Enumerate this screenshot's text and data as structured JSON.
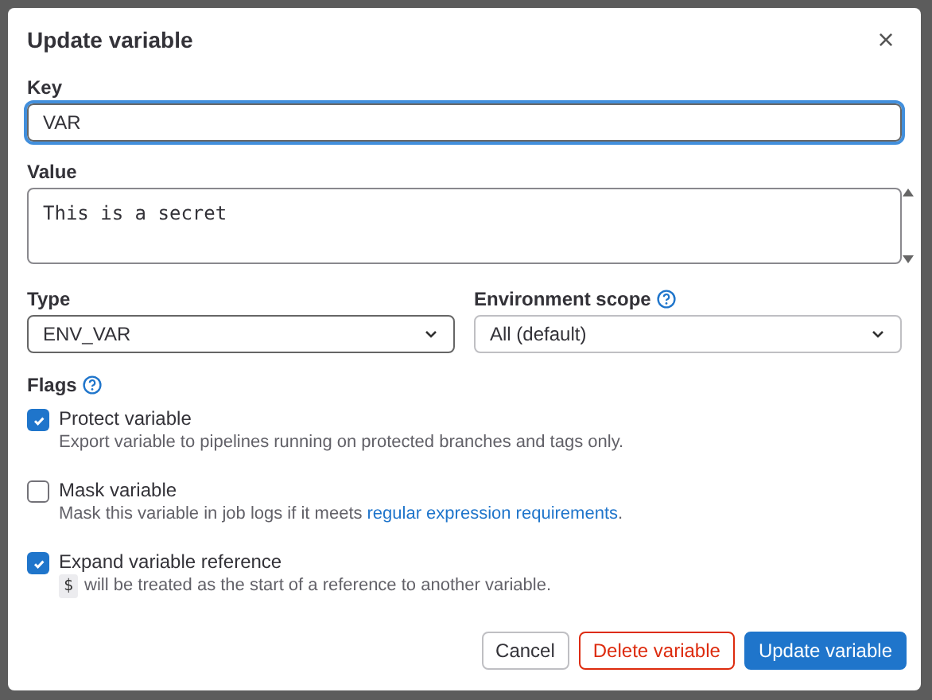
{
  "dialog": {
    "title": "Update variable",
    "close": "×"
  },
  "key": {
    "label": "Key",
    "value": "VAR"
  },
  "value": {
    "label": "Value",
    "value": "This is a secret"
  },
  "type": {
    "label": "Type",
    "value": "ENV_VAR"
  },
  "environment_scope": {
    "label": "Environment scope",
    "value": "All (default)"
  },
  "flags": {
    "label": "Flags",
    "items": [
      {
        "label": "Protect variable",
        "checked": true,
        "description": "Export variable to pipelines running on protected branches and tags only."
      },
      {
        "label": "Mask variable",
        "checked": false,
        "description": "Mask this variable in job logs if it meets",
        "link": "regular expression requirements",
        "description_after": "."
      },
      {
        "label": "Expand variable reference",
        "checked": true,
        "code": "$",
        "description": "will be treated as the start of a reference to another variable."
      }
    ]
  },
  "buttons": [
    {
      "label": "Cancel",
      "kind": "default"
    },
    {
      "label": "Delete variable",
      "kind": "danger"
    },
    {
      "label": "Update variable",
      "kind": "primary"
    }
  ]
}
